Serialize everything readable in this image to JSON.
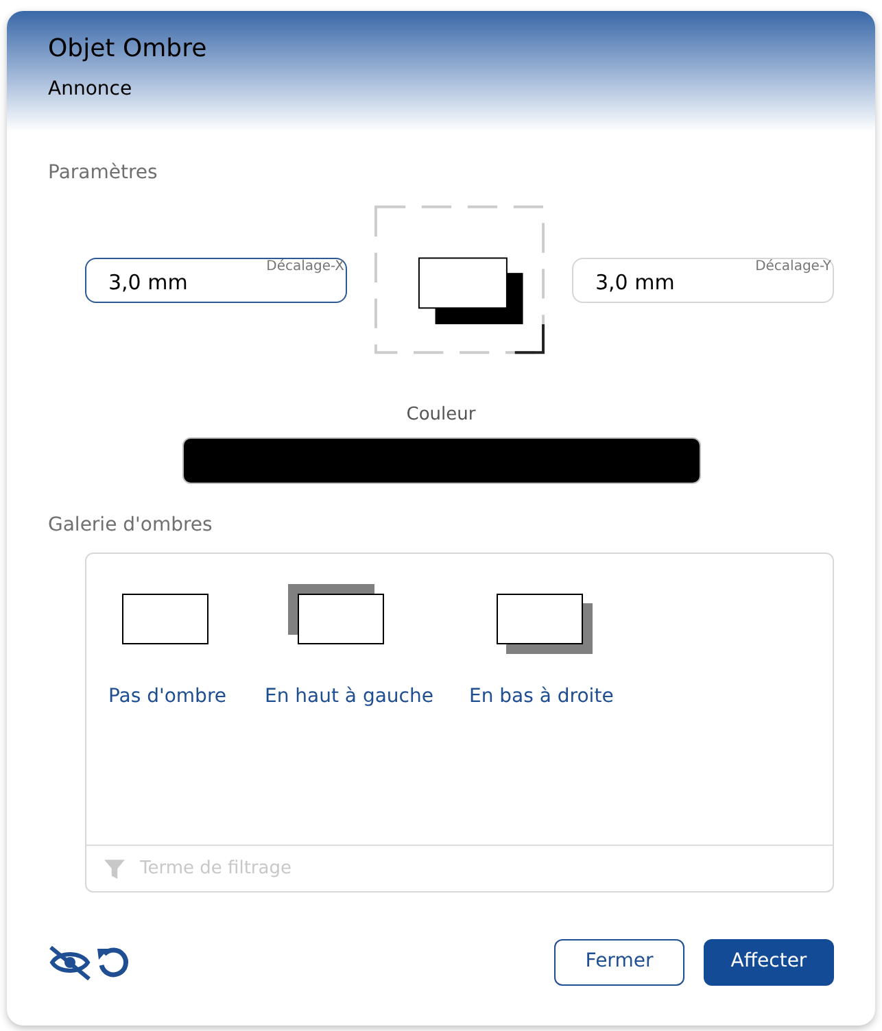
{
  "dialog": {
    "title": "Objet Ombre",
    "subtitle": "Annonce"
  },
  "parameters": {
    "heading": "Paramètres",
    "offset_x": {
      "label": "Décalage-X",
      "value": "3,0 mm",
      "focused": true
    },
    "offset_y": {
      "label": "Décalage-Y",
      "value": "3,0 mm",
      "focused": false
    },
    "color": {
      "label": "Couleur",
      "color": "#000000"
    }
  },
  "gallery": {
    "heading": "Galerie d'ombres",
    "items": [
      {
        "kind": "none",
        "label": "Pas d'ombre"
      },
      {
        "kind": "top-left",
        "label": "En haut à gauche"
      },
      {
        "kind": "bottom-right",
        "label": "En bas à droite"
      }
    ],
    "filter": {
      "placeholder": "Terme de filtrage"
    }
  },
  "buttons": [
    {
      "label": "Fermer",
      "primary": false
    },
    {
      "label": "Affecter",
      "primary": true
    }
  ]
}
